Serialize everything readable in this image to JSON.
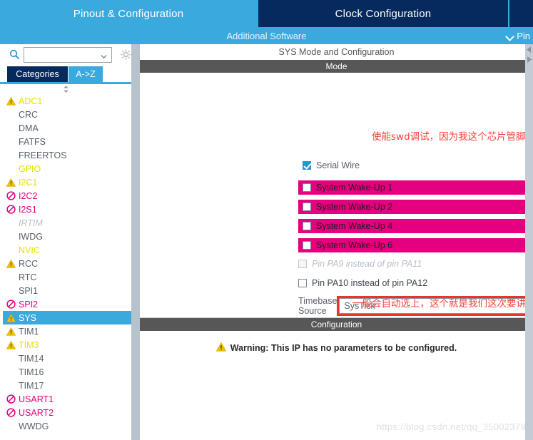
{
  "tabs": [
    {
      "label": "Pinout & Configuration",
      "active": true
    },
    {
      "label": "Clock Configuration",
      "active": false
    },
    {
      "label": "",
      "active": false
    }
  ],
  "subbar": {
    "additional_software": "Additional Software",
    "pinout_label": "Pin",
    "chevron_icon": "chevron-down-icon"
  },
  "sidebar": {
    "search": {
      "value": "",
      "placeholder": "",
      "search_icon": "search-icon",
      "combo_icon": "chevron-down-icon"
    },
    "gear_icon": "gear-icon",
    "sort_icon": "sort-updown-icon",
    "category_tabs": [
      {
        "label": "Categories",
        "selected": true
      },
      {
        "label": "A->Z",
        "selected": false
      }
    ],
    "items": [
      {
        "label": "ADC1",
        "icon": "warning-icon",
        "color": "yellow",
        "selected": false
      },
      {
        "label": "CRC",
        "icon": "none",
        "color": "plain",
        "selected": false
      },
      {
        "label": "DMA",
        "icon": "none",
        "color": "plain",
        "selected": false
      },
      {
        "label": "FATFS",
        "icon": "none",
        "color": "plain",
        "selected": false
      },
      {
        "label": "FREERTOS",
        "icon": "none",
        "color": "plain",
        "selected": false
      },
      {
        "label": "GPIO",
        "icon": "none",
        "color": "yellow",
        "selected": false
      },
      {
        "label": "I2C1",
        "icon": "warning-icon",
        "color": "yellow",
        "selected": false
      },
      {
        "label": "I2C2",
        "icon": "forbidden-icon",
        "color": "pink",
        "selected": false
      },
      {
        "label": "I2S1",
        "icon": "forbidden-icon",
        "color": "pink",
        "selected": false
      },
      {
        "label": "IRTIM",
        "icon": "none",
        "color": "grey",
        "selected": false
      },
      {
        "label": "IWDG",
        "icon": "none",
        "color": "plain",
        "selected": false
      },
      {
        "label": "NVIC",
        "icon": "none",
        "color": "yellow",
        "selected": false
      },
      {
        "label": "RCC",
        "icon": "warning-icon",
        "color": "plain",
        "selected": false
      },
      {
        "label": "RTC",
        "icon": "none",
        "color": "plain",
        "selected": false
      },
      {
        "label": "SPI1",
        "icon": "none",
        "color": "plain",
        "selected": false
      },
      {
        "label": "SPI2",
        "icon": "forbidden-icon",
        "color": "pink",
        "selected": false
      },
      {
        "label": "SYS",
        "icon": "warning-icon",
        "color": "plain",
        "selected": true
      },
      {
        "label": "TIM1",
        "icon": "warning-icon",
        "color": "plain",
        "selected": false
      },
      {
        "label": "TIM3",
        "icon": "warning-icon",
        "color": "yellow",
        "selected": false
      },
      {
        "label": "TIM14",
        "icon": "none",
        "color": "plain",
        "selected": false
      },
      {
        "label": "TIM16",
        "icon": "none",
        "color": "plain",
        "selected": false
      },
      {
        "label": "TIM17",
        "icon": "none",
        "color": "plain",
        "selected": false
      },
      {
        "label": "USART1",
        "icon": "forbidden-icon",
        "color": "pink",
        "selected": false
      },
      {
        "label": "USART2",
        "icon": "forbidden-icon",
        "color": "pink",
        "selected": false
      },
      {
        "label": "WWDG",
        "icon": "none",
        "color": "plain",
        "selected": false
      }
    ]
  },
  "main": {
    "panel_title": "SYS Mode and Configuration",
    "mode_header": "Mode",
    "serial_wire": {
      "label": "Serial Wire",
      "checked": true
    },
    "wakeups": [
      {
        "label": "System Wake-Up 1",
        "checked": false
      },
      {
        "label": "System Wake-Up 2",
        "checked": false
      },
      {
        "label": "System Wake-Up 4",
        "checked": false
      },
      {
        "label": "System Wake-Up 6",
        "checked": false
      }
    ],
    "pin_options": [
      {
        "label": "Pin PA9 instead of pin PA11",
        "checked": false,
        "disabled": true
      },
      {
        "label": "Pin PA10 instead of pin PA12",
        "checked": false,
        "disabled": false
      }
    ],
    "timebase": {
      "label": "Timebase Source",
      "value": "SysTick",
      "combo_icon": "chevron-down-icon",
      "highlight_color": "#e8352a"
    },
    "configuration_header": "Configuration",
    "warning": {
      "icon": "warning-icon",
      "text": "Warning: This IP has no parameters to be configured."
    },
    "scroll_up_icon": "scroll-up-icon",
    "scroll_down_icon": "scroll-down-icon"
  },
  "annotations": {
    "top": "使能swd调试，因为我这个芯片管脚少，只支持swd调试",
    "bottom": "一般会自动选上，这个就是我们这次要讲的systick",
    "color": "#f5413a"
  },
  "watermark": "https://blog.csdn.net/qq_35002379",
  "colors": {
    "tab_active": "#3aa9dd",
    "tab_inactive": "#062a5d",
    "magenta": "#e4007f",
    "section_header": "#575757",
    "warning_yellow": "#f2c200"
  }
}
